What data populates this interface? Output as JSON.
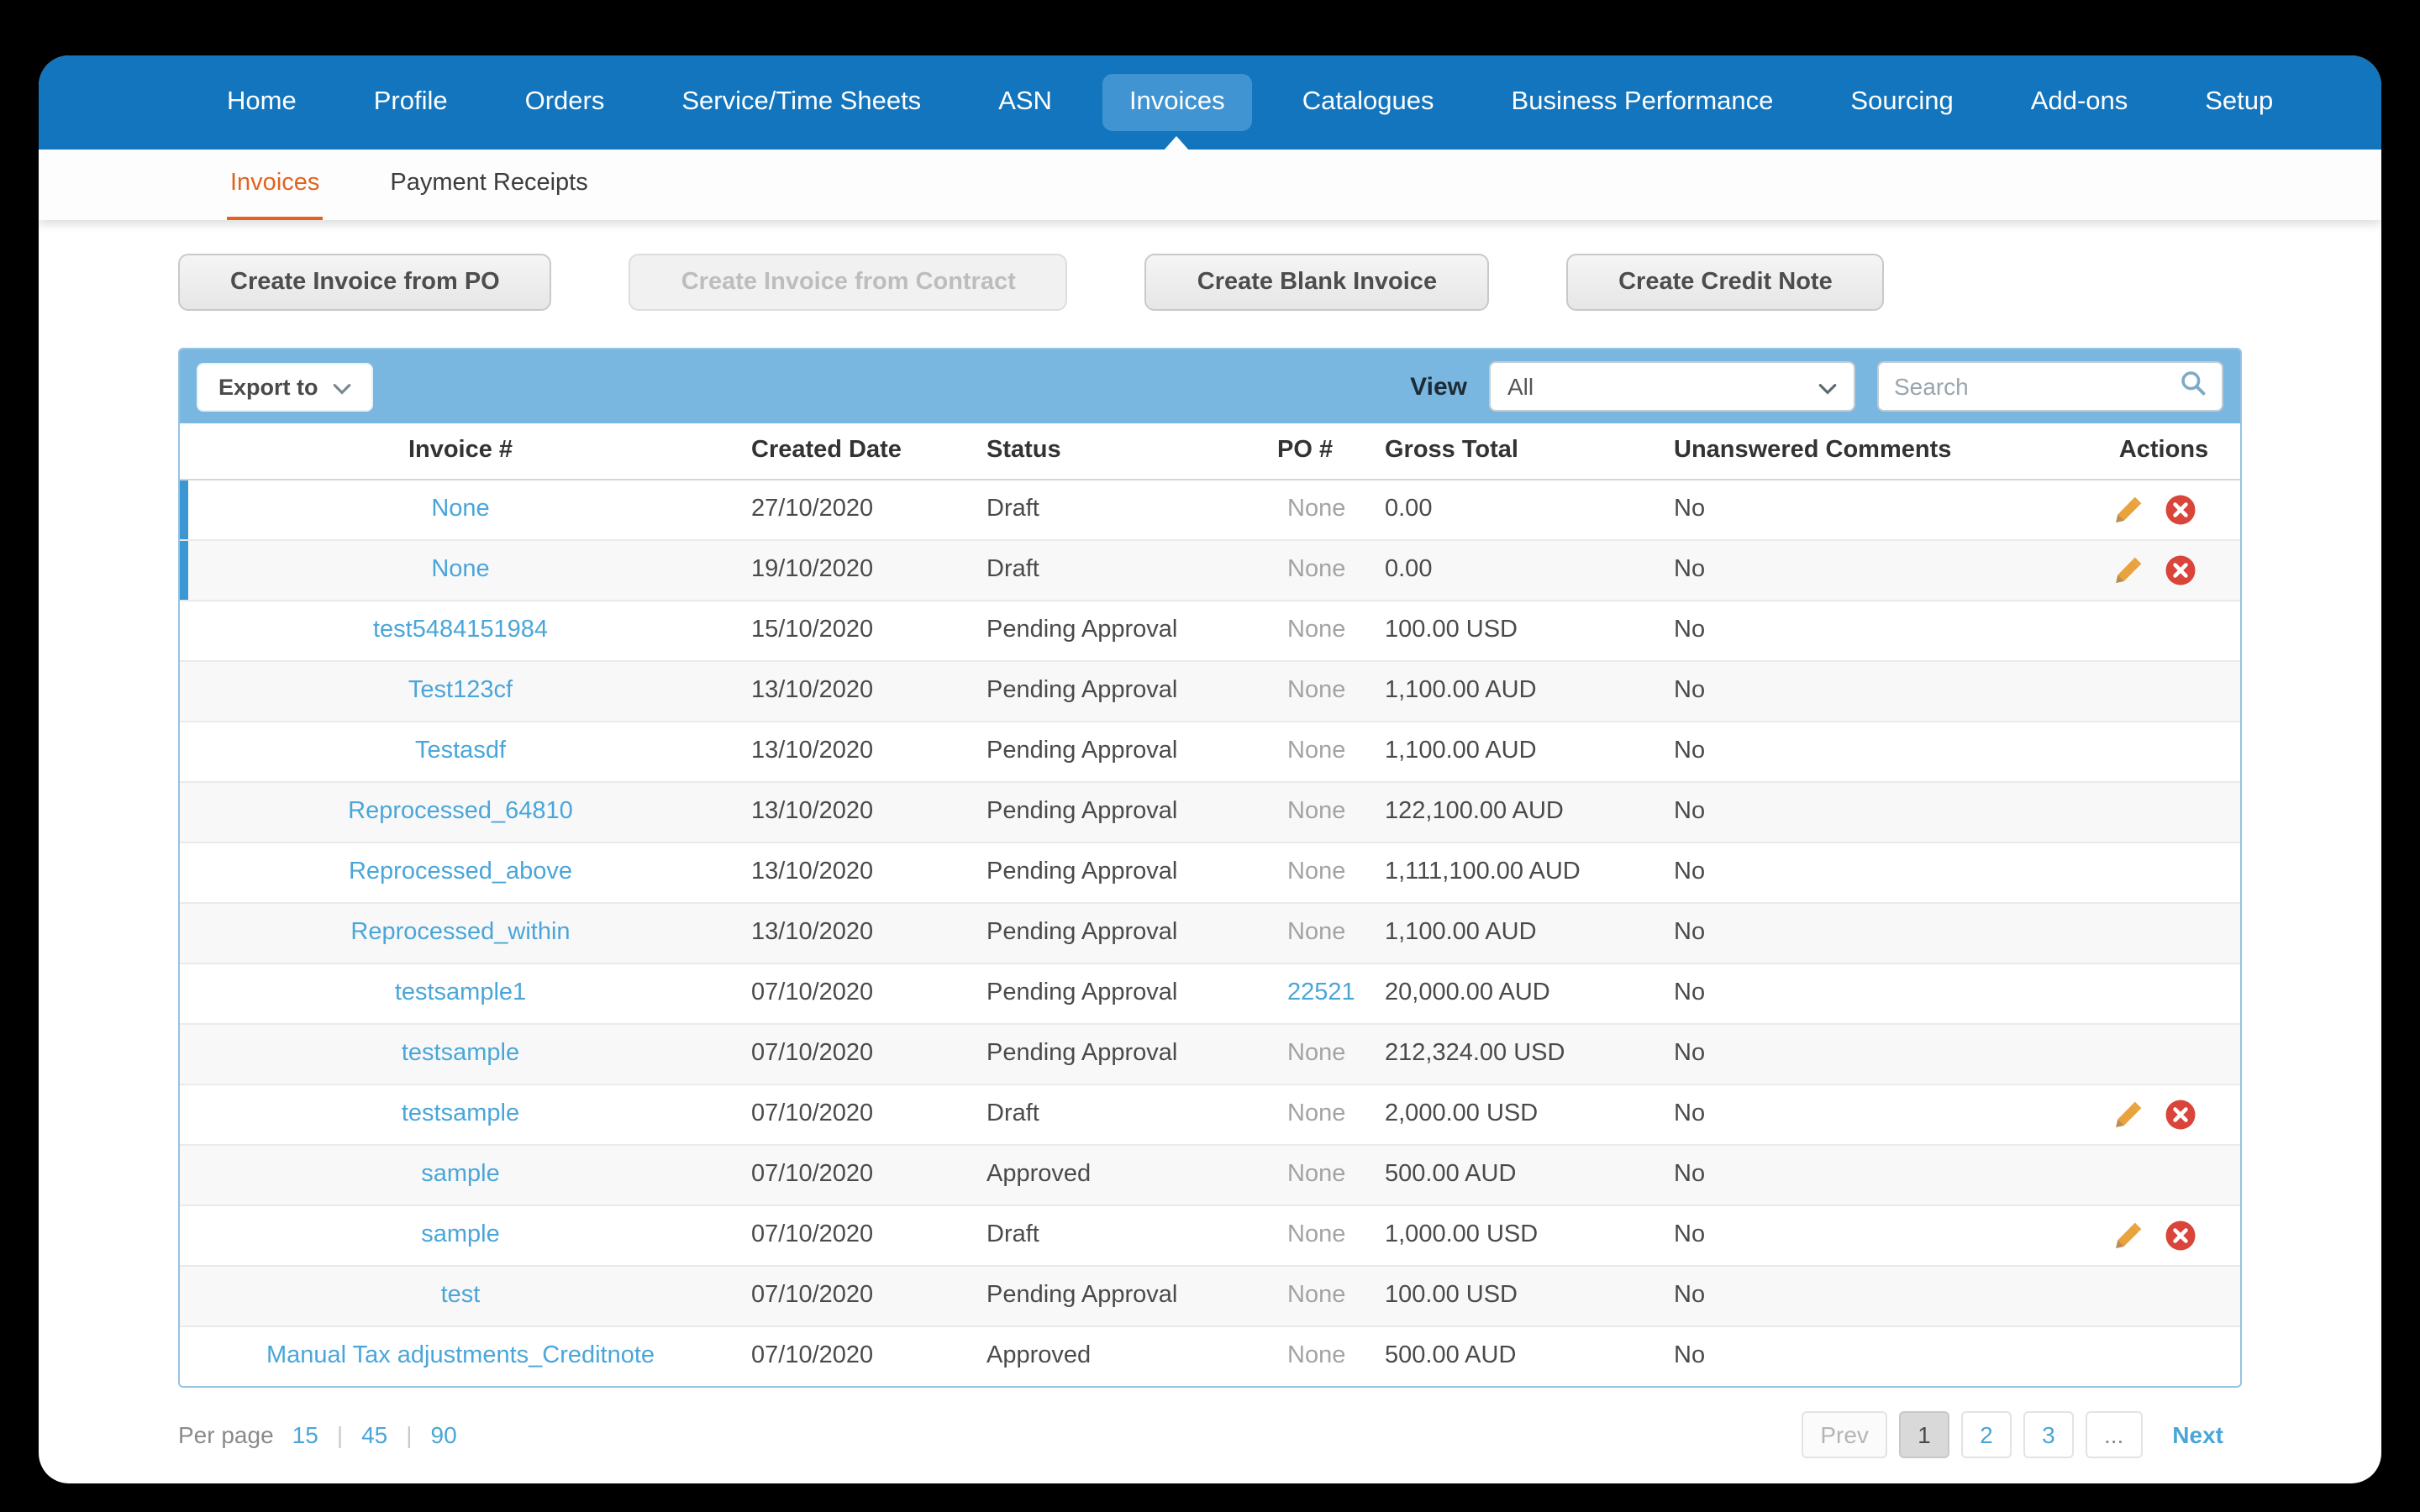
{
  "colors": {
    "nav_blue": "#1375bd",
    "nav_active_blue": "#4094d1",
    "band_blue": "#7ab7e0",
    "link_blue": "#4aa6d9",
    "active_orange": "#e2631e",
    "delete_red": "#d9453a",
    "pencil_orange": "#e8a33e"
  },
  "nav": {
    "items": [
      "Home",
      "Profile",
      "Orders",
      "Service/Time Sheets",
      "ASN",
      "Invoices",
      "Catalogues",
      "Business Performance",
      "Sourcing",
      "Add-ons",
      "Setup"
    ],
    "active_item": "Invoices"
  },
  "subnav": {
    "items": [
      "Invoices",
      "Payment Receipts"
    ],
    "active_item": "Invoices"
  },
  "action_buttons": [
    {
      "label": "Create Invoice from PO",
      "enabled": true
    },
    {
      "label": "Create Invoice from Contract",
      "enabled": false
    },
    {
      "label": "Create Blank Invoice",
      "enabled": true
    },
    {
      "label": "Create Credit Note",
      "enabled": true
    }
  ],
  "toolbar": {
    "export_label": "Export to",
    "view_label": "View",
    "view_value": "All",
    "search_placeholder": "Search"
  },
  "icons": {
    "export_caret": "chevron-down-icon",
    "view_caret": "chevron-down-icon",
    "search": "magnifier-icon",
    "edit": "pencil-icon",
    "delete": "circle-x-icon"
  },
  "table": {
    "columns": [
      "Invoice #",
      "Created Date",
      "Status",
      "PO #",
      "Gross Total",
      "Unanswered Comments",
      "Actions"
    ],
    "rows": [
      {
        "invoice": "None",
        "created": "27/10/2020",
        "status": "Draft",
        "po": "None",
        "po_is_link": false,
        "gross": "0.00",
        "comments": "No",
        "has_actions": true,
        "selected": true
      },
      {
        "invoice": "None",
        "created": "19/10/2020",
        "status": "Draft",
        "po": "None",
        "po_is_link": false,
        "gross": "0.00",
        "comments": "No",
        "has_actions": true,
        "selected": true
      },
      {
        "invoice": "test5484151984",
        "created": "15/10/2020",
        "status": "Pending Approval",
        "po": "None",
        "po_is_link": false,
        "gross": "100.00 USD",
        "comments": "No",
        "has_actions": false,
        "selected": false
      },
      {
        "invoice": "Test123cf",
        "created": "13/10/2020",
        "status": "Pending Approval",
        "po": "None",
        "po_is_link": false,
        "gross": "1,100.00 AUD",
        "comments": "No",
        "has_actions": false,
        "selected": false
      },
      {
        "invoice": "Testasdf",
        "created": "13/10/2020",
        "status": "Pending Approval",
        "po": "None",
        "po_is_link": false,
        "gross": "1,100.00 AUD",
        "comments": "No",
        "has_actions": false,
        "selected": false
      },
      {
        "invoice": "Reprocessed_64810",
        "created": "13/10/2020",
        "status": "Pending Approval",
        "po": "None",
        "po_is_link": false,
        "gross": "122,100.00 AUD",
        "comments": "No",
        "has_actions": false,
        "selected": false
      },
      {
        "invoice": "Reprocessed_above",
        "created": "13/10/2020",
        "status": "Pending Approval",
        "po": "None",
        "po_is_link": false,
        "gross": "1,111,100.00 AUD",
        "comments": "No",
        "has_actions": false,
        "selected": false
      },
      {
        "invoice": "Reprocessed_within",
        "created": "13/10/2020",
        "status": "Pending Approval",
        "po": "None",
        "po_is_link": false,
        "gross": "1,100.00 AUD",
        "comments": "No",
        "has_actions": false,
        "selected": false
      },
      {
        "invoice": "testsample1",
        "created": "07/10/2020",
        "status": "Pending Approval",
        "po": "22521",
        "po_is_link": true,
        "gross": "20,000.00 AUD",
        "comments": "No",
        "has_actions": false,
        "selected": false
      },
      {
        "invoice": "testsample",
        "created": "07/10/2020",
        "status": "Pending Approval",
        "po": "None",
        "po_is_link": false,
        "gross": "212,324.00 USD",
        "comments": "No",
        "has_actions": false,
        "selected": false
      },
      {
        "invoice": "testsample",
        "created": "07/10/2020",
        "status": "Draft",
        "po": "None",
        "po_is_link": false,
        "gross": "2,000.00 USD",
        "comments": "No",
        "has_actions": true,
        "selected": false
      },
      {
        "invoice": "sample",
        "created": "07/10/2020",
        "status": "Approved",
        "po": "None",
        "po_is_link": false,
        "gross": "500.00 AUD",
        "comments": "No",
        "has_actions": false,
        "selected": false
      },
      {
        "invoice": "sample",
        "created": "07/10/2020",
        "status": "Draft",
        "po": "None",
        "po_is_link": false,
        "gross": "1,000.00 USD",
        "comments": "No",
        "has_actions": true,
        "selected": false
      },
      {
        "invoice": "test",
        "created": "07/10/2020",
        "status": "Pending Approval",
        "po": "None",
        "po_is_link": false,
        "gross": "100.00 USD",
        "comments": "No",
        "has_actions": false,
        "selected": false
      },
      {
        "invoice": "Manual Tax adjustments_Creditnote",
        "created": "07/10/2020",
        "status": "Approved",
        "po": "None",
        "po_is_link": false,
        "gross": "500.00 AUD",
        "comments": "No",
        "has_actions": false,
        "selected": false
      }
    ]
  },
  "pagination": {
    "per_page_label": "Per page",
    "per_page_options": [
      "15",
      "45",
      "90"
    ],
    "separator": "|",
    "prev_label": "Prev",
    "pages": [
      "1",
      "2",
      "3"
    ],
    "current_page": "1",
    "ellipsis_label": "...",
    "next_label": "Next"
  }
}
